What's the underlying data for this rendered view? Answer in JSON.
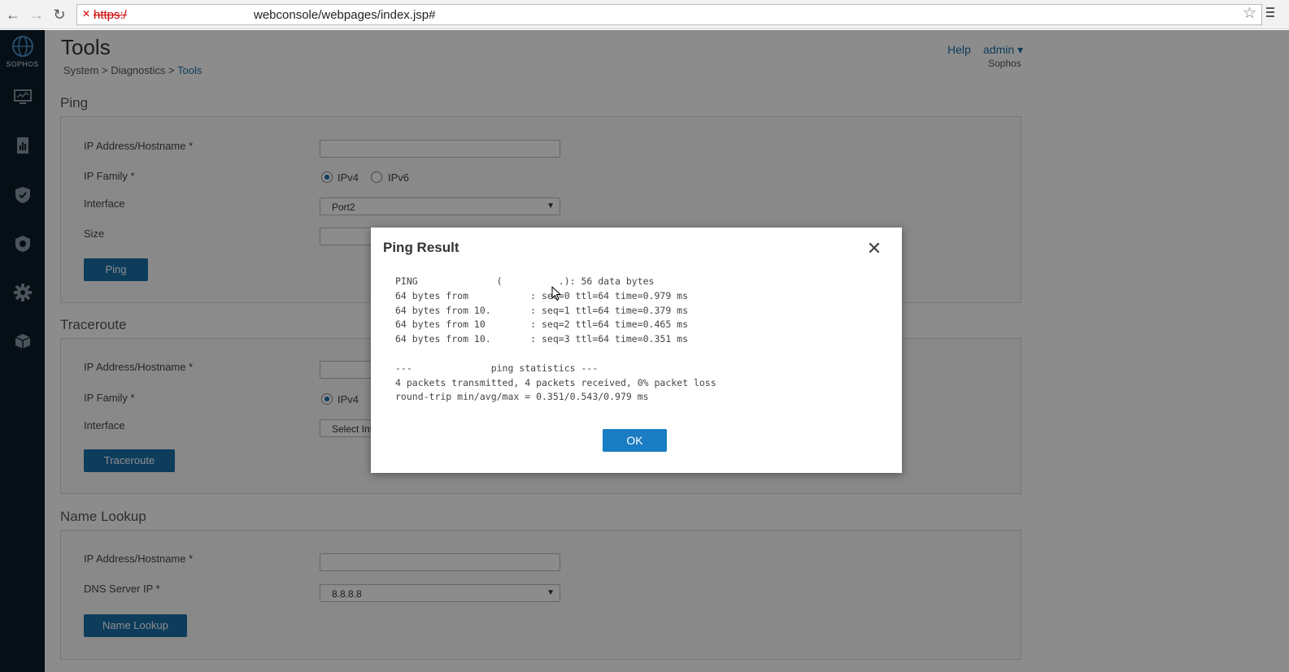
{
  "browser": {
    "url_scheme": "https:/",
    "url_path": "webconsole/webpages/index.jsp#"
  },
  "sidebar": {
    "logo_text": "SOPHOS",
    "icons": [
      "monitor-icon",
      "reports-icon",
      "shield-icon",
      "protection-icon",
      "gear-icon",
      "box-icon"
    ]
  },
  "header": {
    "title": "Tools",
    "breadcrumb": {
      "system": "System",
      "diagnostics": "Diagnostics",
      "tools": "Tools",
      "separator": ">"
    },
    "help": "Help",
    "admin": "admin ▾",
    "org": "Sophos"
  },
  "ping": {
    "section": "Ping",
    "ip_label": "IP Address/Hostname *",
    "family_label": "IP Family *",
    "ipv4": "IPv4",
    "ipv6": "IPv6",
    "interface_label": "Interface",
    "interface_value": "Port2",
    "size_label": "Size",
    "button": "Ping"
  },
  "traceroute": {
    "section": "Traceroute",
    "ip_label": "IP Address/Hostname *",
    "family_label": "IP Family *",
    "ipv4": "IPv4",
    "interface_label": "Interface",
    "interface_value": "Select Int",
    "button": "Traceroute"
  },
  "lookup": {
    "section": "Name Lookup",
    "ip_label": "IP Address/Hostname *",
    "dns_label": "DNS Server IP *",
    "dns_value": "8.8.8.8",
    "button": "Name Lookup"
  },
  "modal": {
    "title": "Ping Result",
    "lines": [
      "PING              (          .): 56 data bytes",
      "64 bytes from           : seq=0 ttl=64 time=0.979 ms",
      "64 bytes from 10.       : seq=1 ttl=64 time=0.379 ms",
      "64 bytes from 10        : seq=2 ttl=64 time=0.465 ms",
      "64 bytes from 10.       : seq=3 ttl=64 time=0.351 ms",
      "",
      "---              ping statistics ---",
      "4 packets transmitted, 4 packets received, 0% packet loss",
      "round-trip min/avg/max = 0.351/0.543/0.979 ms"
    ],
    "ok": "OK"
  }
}
